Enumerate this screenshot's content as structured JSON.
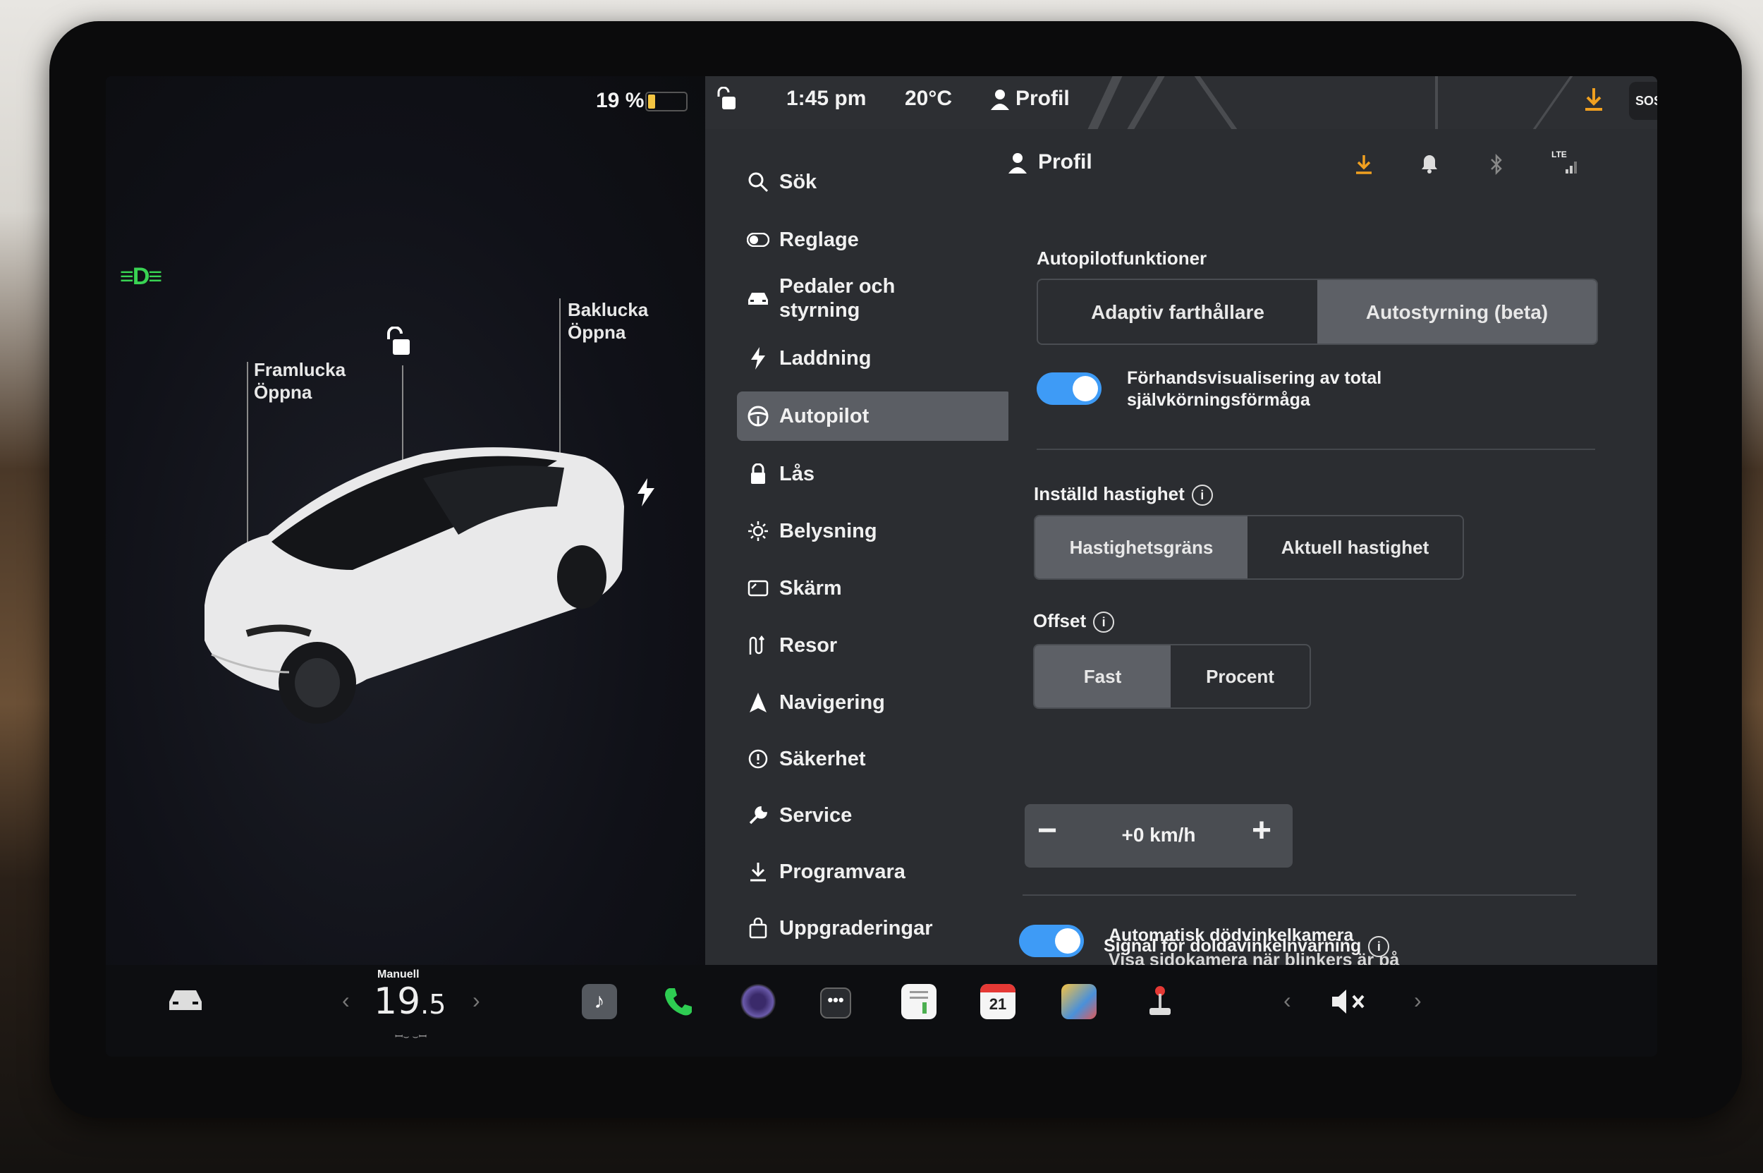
{
  "car_pane": {
    "battery_percent": "19 %",
    "battery_level": 0.19,
    "frunk": {
      "label": "Framlucka",
      "action": "Öppna"
    },
    "trunk": {
      "label": "Baklucka",
      "action": "Öppna"
    }
  },
  "status_bar": {
    "time": "1:45 pm",
    "temperature": "20°C",
    "profile": "Profil",
    "sos": "SOS"
  },
  "menu": {
    "items": [
      {
        "label": "Sök",
        "icon": "search-icon"
      },
      {
        "label": "Reglage",
        "icon": "toggle-icon"
      },
      {
        "label": "Pedaler och styrning",
        "icon": "car-icon"
      },
      {
        "label": "Laddning",
        "icon": "bolt-icon"
      },
      {
        "label": "Autopilot",
        "icon": "steering-wheel-icon",
        "active": true
      },
      {
        "label": "Lås",
        "icon": "lock-icon"
      },
      {
        "label": "Belysning",
        "icon": "sun-icon"
      },
      {
        "label": "Skärm",
        "icon": "display-icon"
      },
      {
        "label": "Resor",
        "icon": "trips-icon"
      },
      {
        "label": "Navigering",
        "icon": "navigation-icon"
      },
      {
        "label": "Säkerhet",
        "icon": "safety-icon"
      },
      {
        "label": "Service",
        "icon": "wrench-icon"
      },
      {
        "label": "Programvara",
        "icon": "download-icon"
      },
      {
        "label": "Uppgraderingar",
        "icon": "shopping-bag-icon"
      }
    ]
  },
  "content": {
    "profile": "Profil",
    "lte": "LTE",
    "autopilot_features": {
      "title": "Autopilotfunktioner",
      "options": [
        "Adaptiv farthållare",
        "Autostyrning (beta)"
      ],
      "selected": "Autostyrning (beta)"
    },
    "fsd_preview": {
      "label": "Förhandsvisualisering av total självkörningsförmåga",
      "enabled": true
    },
    "set_speed": {
      "title": "Inställd hastighet",
      "options": [
        "Hastighetsgräns",
        "Aktuell hastighet"
      ],
      "selected": "Hastighetsgräns"
    },
    "offset": {
      "title": "Offset",
      "options": [
        "Fast",
        "Procent"
      ],
      "selected": "Fast",
      "value": "+0 km/h",
      "minus": "−",
      "plus": "+"
    },
    "blind_spot_camera": {
      "title": "Automatisk dödvinkelkamera",
      "subtitle": "Visa sidokamera när blinkers är på",
      "enabled": true
    },
    "blind_spot_chime": {
      "label": "Signal för doldavinkelnvarning",
      "enabled": true
    }
  },
  "dock": {
    "climate_mode": "Manuell",
    "temperature": "19",
    "temperature_decimal": ".5",
    "calendar_day": "21"
  },
  "colors": {
    "accent": "#3e9bf6",
    "headlight": "#39d353",
    "battery": "#f4c542",
    "download": "#f0a020"
  }
}
